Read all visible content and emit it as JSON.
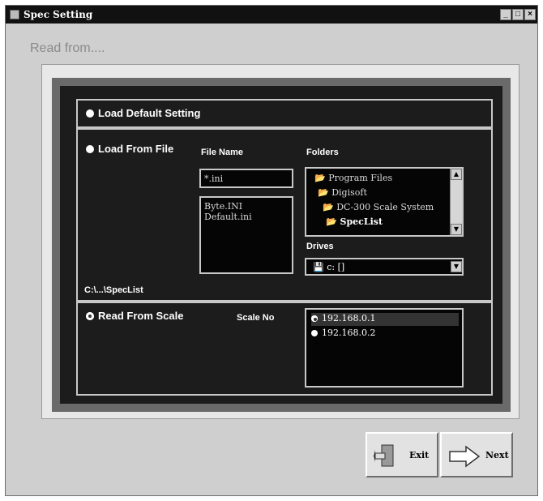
{
  "window": {
    "title": "Spec Setting",
    "buttons": [
      "_",
      "□",
      "×"
    ]
  },
  "header": {
    "read_from": "Read from...."
  },
  "default_section": {
    "option_label": "Load Default Setting"
  },
  "file_section": {
    "option_label": "Load From File",
    "file_name_label": "File Name",
    "file_name_value": "*.ini",
    "files": [
      "Byte.INI",
      "Default.ini"
    ],
    "folders_label": "Folders",
    "folders": [
      "Program Files",
      "Digisoft",
      "DC-300 Scale System",
      "SpecList"
    ],
    "drives_label": "Drives",
    "drive_value": "c: []",
    "path_text": "C:\\...\\SpecList"
  },
  "scale_section": {
    "option_label": "Read From Scale",
    "scale_no_label": "Scale No",
    "scales": [
      "192.168.0.1",
      "192.168.0.2"
    ],
    "selected_index": 0
  },
  "footer": {
    "exit_label": "Exit",
    "next_label": "Next"
  }
}
